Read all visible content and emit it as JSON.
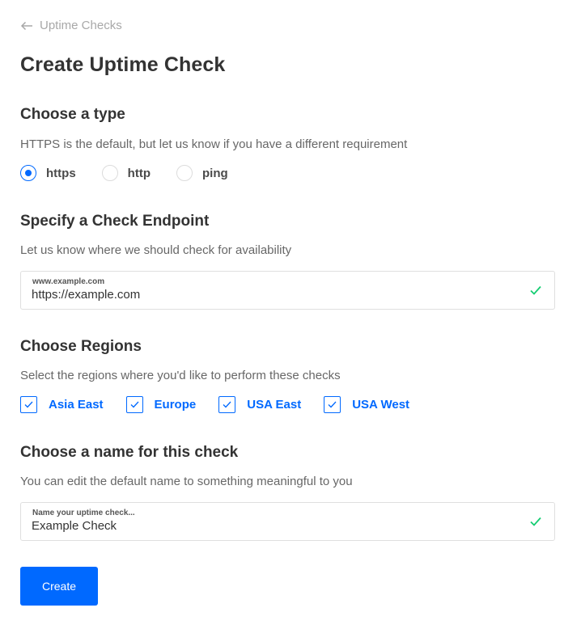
{
  "breadcrumb": {
    "back_label": "Uptime Checks",
    "icon": "arrow-left-icon"
  },
  "page": {
    "title": "Create Uptime Check"
  },
  "type_section": {
    "title": "Choose a type",
    "description": "HTTPS is the default, but let us know if you have a different requirement",
    "options": [
      {
        "label": "https",
        "checked": true
      },
      {
        "label": "http",
        "checked": false
      },
      {
        "label": "ping",
        "checked": false
      }
    ]
  },
  "endpoint_section": {
    "title": "Specify a Check Endpoint",
    "description": "Let us know where we should check for availability",
    "field": {
      "label": "www.example.com",
      "value": "https://example.com",
      "valid": true
    }
  },
  "regions_section": {
    "title": "Choose Regions",
    "description": "Select the regions where you'd like to perform these checks",
    "options": [
      {
        "label": "Asia East",
        "checked": true
      },
      {
        "label": "Europe",
        "checked": true
      },
      {
        "label": "USA East",
        "checked": true
      },
      {
        "label": "USA West",
        "checked": true
      }
    ]
  },
  "name_section": {
    "title": "Choose a name for this check",
    "description": "You can edit the default name to something meaningful to you",
    "field": {
      "label": "Name your uptime check...",
      "value": "Example Check",
      "valid": true
    }
  },
  "actions": {
    "create_label": "Create"
  },
  "colors": {
    "accent": "#0069ff",
    "success": "#15cd72",
    "heading": "#333333",
    "muted": "#676767"
  }
}
